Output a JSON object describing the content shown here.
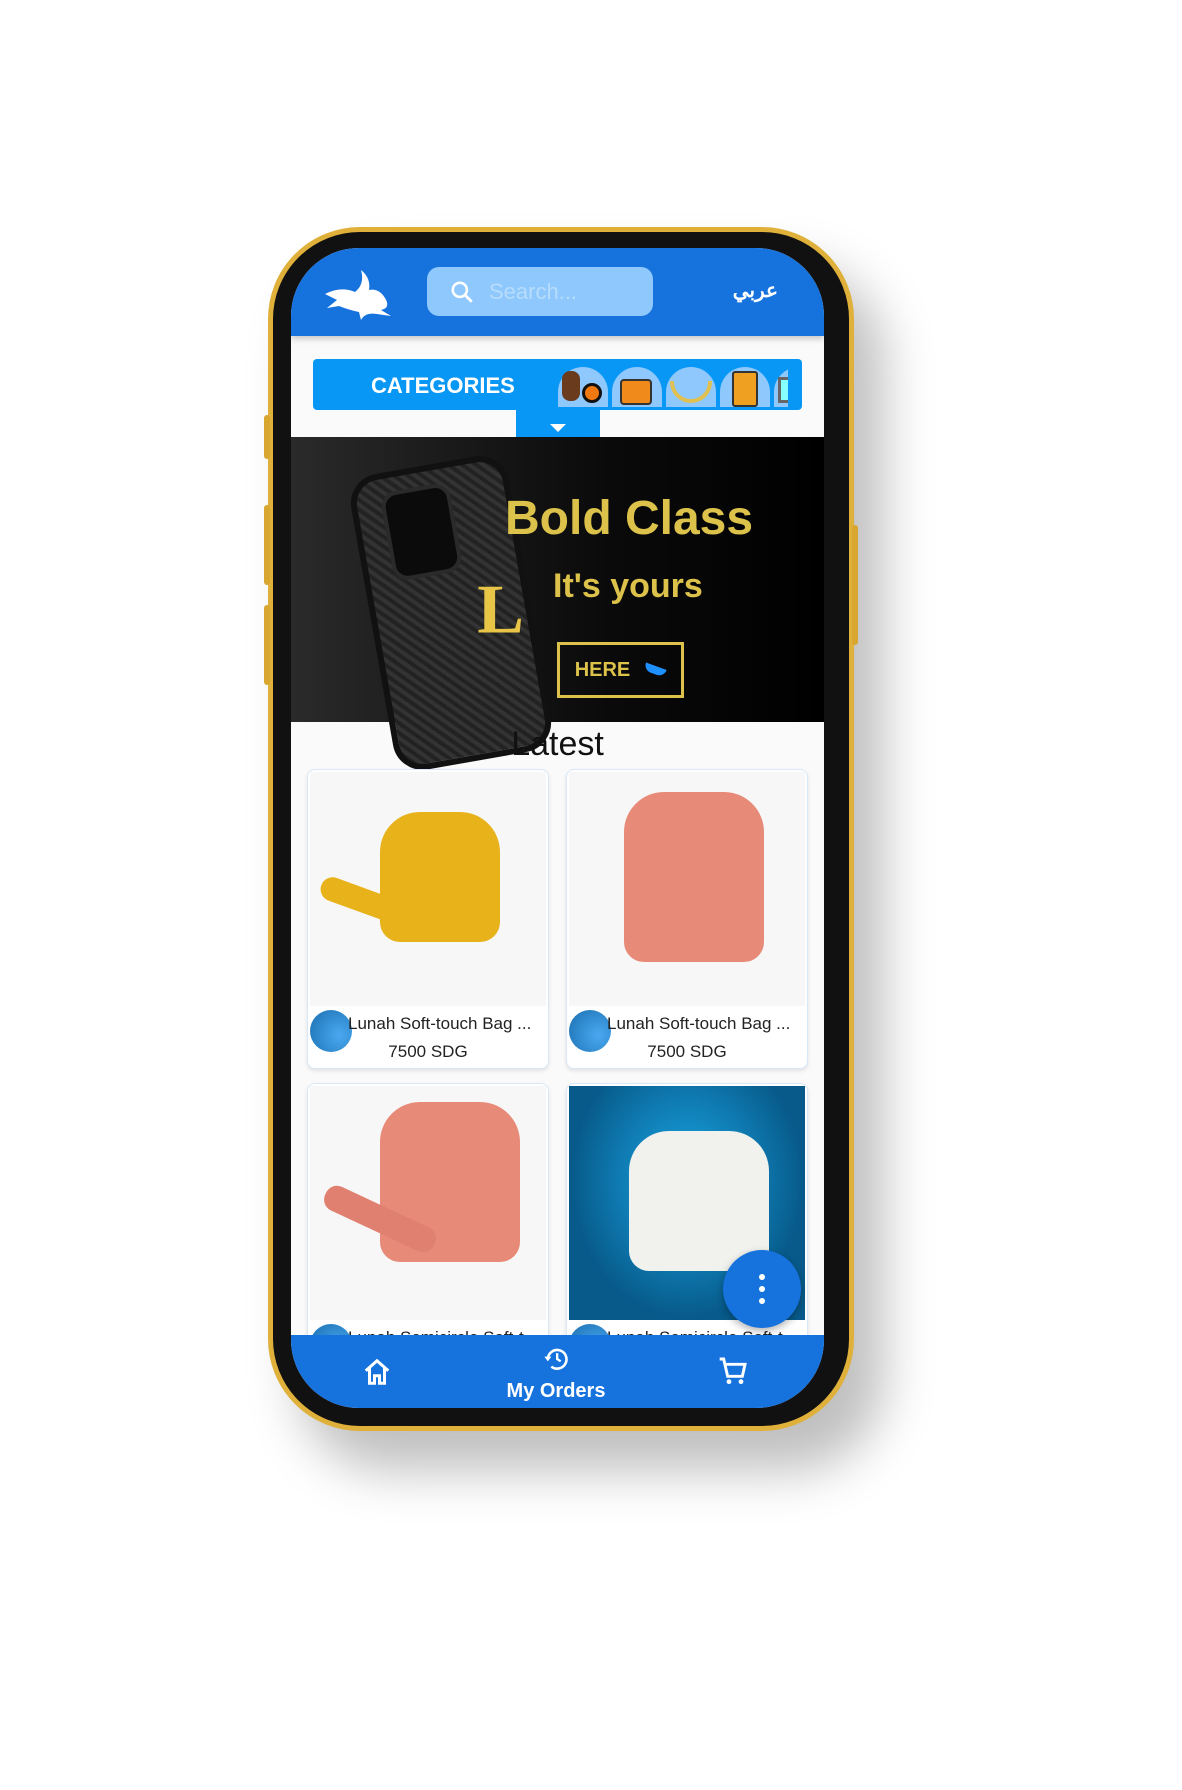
{
  "header": {
    "search_placeholder": "Search...",
    "language_toggle": "عربي"
  },
  "categories": {
    "label": "CATEGORIES",
    "icons": [
      "sports-icon",
      "handbag-icon",
      "necklace-icon",
      "phone-icon",
      "appliance-icon"
    ]
  },
  "banner": {
    "title": "Bold Class",
    "subtitle": "It's yours",
    "button_label": "HERE",
    "monogram": "LV"
  },
  "latest": {
    "heading": "Latest",
    "products": [
      {
        "title": "Lunah Soft-touch Bag ...",
        "price": "7500 SDG",
        "color": "#e8b21a"
      },
      {
        "title": "Lunah Soft-touch Bag ...",
        "price": "7500 SDG",
        "color": "#e88a78"
      },
      {
        "title": "Lunah Semicircle Soft-t...",
        "price": "",
        "color": "#e88a78"
      },
      {
        "title": "Lunah Semicircle Soft-t...",
        "price": "",
        "color": "#f1f1ee"
      }
    ]
  },
  "bottom_nav": {
    "orders_label": "My Orders"
  },
  "colors": {
    "primary": "#1673de",
    "accent": "#0997f5",
    "gold": "#dcc24a"
  }
}
